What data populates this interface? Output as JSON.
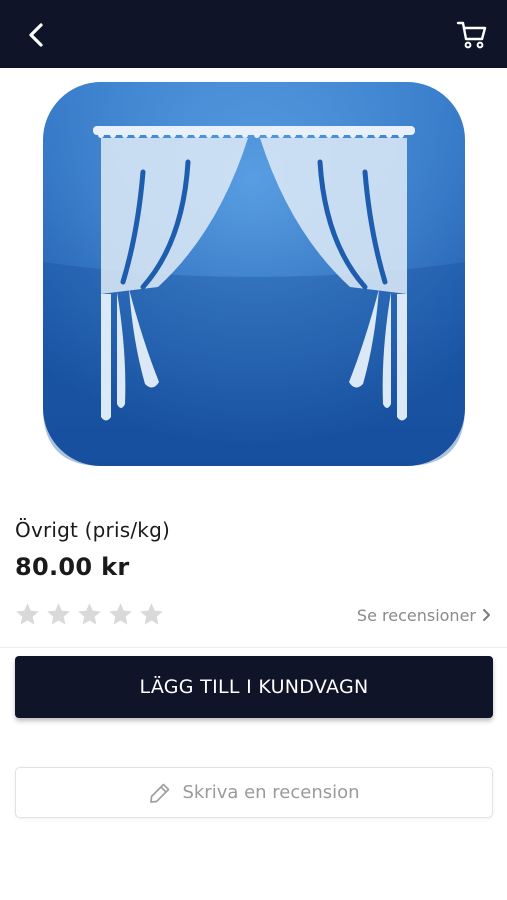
{
  "header": {
    "back_icon": "chevron-left-icon",
    "cart_icon": "shopping-cart-icon",
    "background": "#0f1428"
  },
  "product": {
    "image": "curtain-icon",
    "title": "Övrigt (pris/kg)",
    "price": "80.00 kr",
    "rating": 0,
    "rating_max": 5
  },
  "reviews": {
    "see_reviews_label": "Se recensioner",
    "write_review_label": "Skriva en recension",
    "write_review_icon": "pencil-icon"
  },
  "actions": {
    "add_to_cart_label": "LÄGG TILL I KUNDVAGN"
  },
  "colors": {
    "accent": "#0f1428",
    "star_empty": "#d9d9d9",
    "muted_text": "#8a8a8a",
    "tile_blue": "#1f5fb0"
  }
}
